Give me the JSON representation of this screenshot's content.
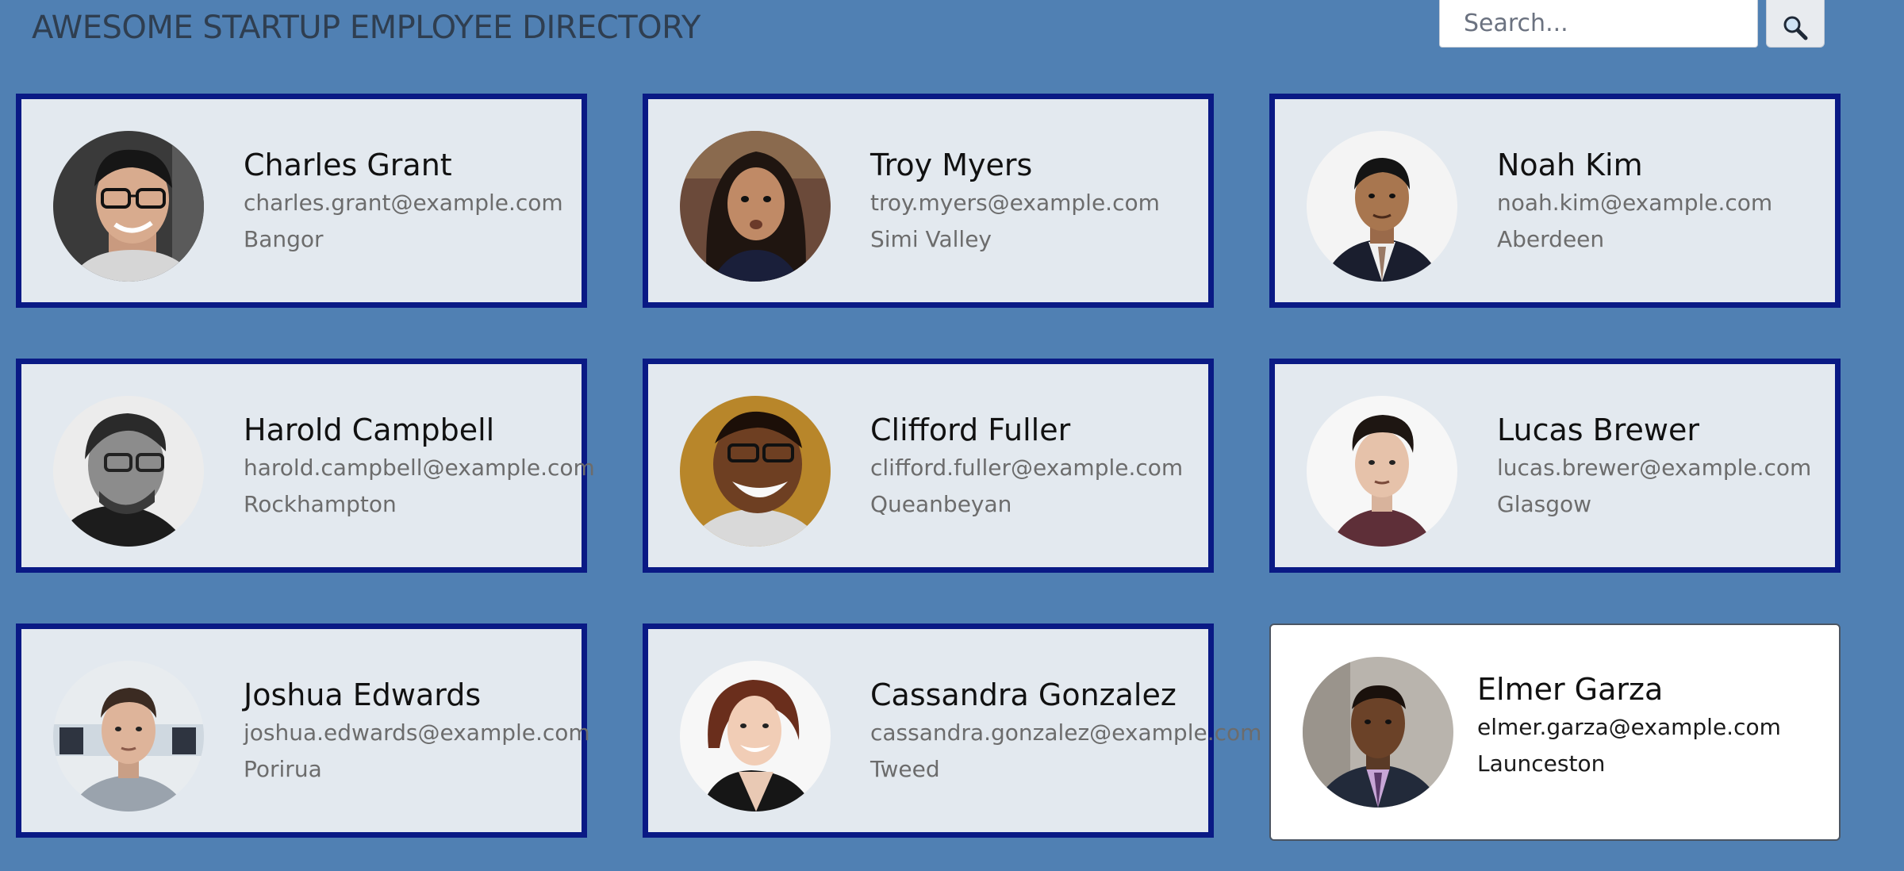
{
  "header": {
    "title": "AWESOME STARTUP EMPLOYEE DIRECTORY",
    "search_placeholder": "Search...",
    "search_button_icon": "search-icon"
  },
  "colors": {
    "page_background": "#5080b3",
    "card_background": "#e3e9ef",
    "card_border": "#0a1a85",
    "highlight_card_background": "#ffffff"
  },
  "employees": [
    {
      "name": "Charles Grant",
      "email": "charles.grant@example.com",
      "city": "Bangor"
    },
    {
      "name": "Troy Myers",
      "email": "troy.myers@example.com",
      "city": "Simi Valley"
    },
    {
      "name": "Noah Kim",
      "email": "noah.kim@example.com",
      "city": "Aberdeen"
    },
    {
      "name": "Harold Campbell",
      "email": "harold.campbell@example.com",
      "city": "Rockhampton"
    },
    {
      "name": "Clifford Fuller",
      "email": "clifford.fuller@example.com",
      "city": "Queanbeyan"
    },
    {
      "name": "Lucas Brewer",
      "email": "lucas.brewer@example.com",
      "city": "Glasgow"
    },
    {
      "name": "Joshua Edwards",
      "email": "joshua.edwards@example.com",
      "city": "Porirua"
    },
    {
      "name": "Cassandra Gonzalez",
      "email": "cassandra.gonzalez@example.com",
      "city": "Tweed"
    },
    {
      "name": "Elmer Garza",
      "email": "elmer.garza@example.com",
      "city": "Launceston"
    }
  ]
}
